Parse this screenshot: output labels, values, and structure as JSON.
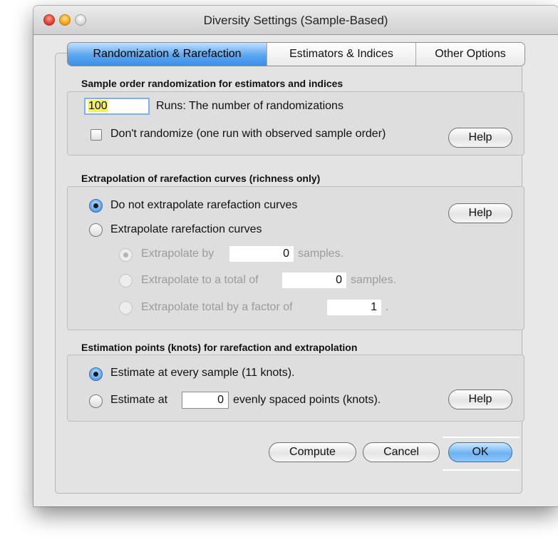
{
  "window": {
    "title": "Diversity Settings (Sample-Based)"
  },
  "tabs": [
    {
      "label": "Randomization & Rarefaction",
      "active": true
    },
    {
      "label": "Estimators & Indices",
      "active": false
    },
    {
      "label": "Other Options",
      "active": false
    }
  ],
  "sample_order": {
    "title": "Sample order randomization for estimators and indices",
    "runs_value": "100",
    "runs_label": "Runs: The number of randomizations",
    "dont_randomize_label": "Don't randomize (one run with observed sample order)",
    "dont_randomize_checked": false,
    "help_label": "Help"
  },
  "extrapolation": {
    "title": "Extrapolation of rarefaction curves (richness only)",
    "no_extrapolate_label": "Do not extrapolate rarefaction curves",
    "extrapolate_label": "Extrapolate rarefaction curves",
    "help_label": "Help",
    "by_label": "Extrapolate by",
    "by_value": "0",
    "by_suffix": "samples.",
    "total_label": "Extrapolate to a total of",
    "total_value": "0",
    "total_suffix": "samples.",
    "factor_label": "Extrapolate total by a factor of",
    "factor_value": "1",
    "factor_suffix": "."
  },
  "estimation": {
    "title": "Estimation points (knots) for rarefaction and extrapolation",
    "every_sample_label": "Estimate at every sample (11 knots).",
    "estimate_at_label": "Estimate at",
    "points_value": "0",
    "points_suffix": "evenly spaced points (knots).",
    "help_label": "Help"
  },
  "buttons": {
    "compute": "Compute",
    "cancel": "Cancel",
    "ok": "OK"
  },
  "colors": {
    "accent": "#5aa6ee",
    "highlight": "#f3ef5e"
  }
}
